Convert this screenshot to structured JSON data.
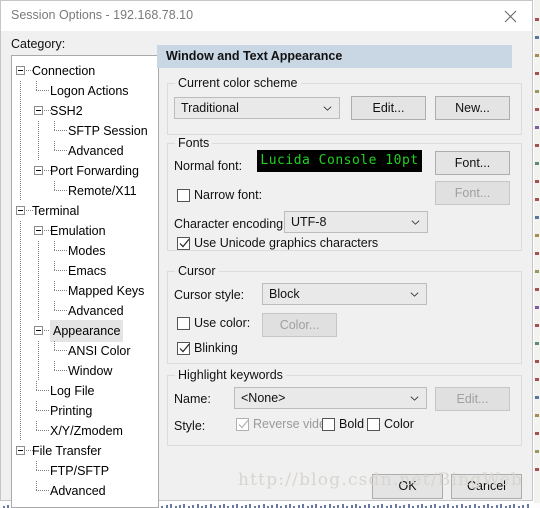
{
  "window": {
    "title": "Session Options - 192.168.78.10",
    "close_icon": "close-icon"
  },
  "category": {
    "label": "Category:",
    "selected": "Appearance",
    "tree": [
      {
        "label": "Connection",
        "depth": 0,
        "expander": "minus"
      },
      {
        "label": "Logon Actions",
        "depth": 1,
        "expander": "none"
      },
      {
        "label": "SSH2",
        "depth": 1,
        "expander": "minus"
      },
      {
        "label": "SFTP Session",
        "depth": 2,
        "expander": "none"
      },
      {
        "label": "Advanced",
        "depth": 2,
        "expander": "none"
      },
      {
        "label": "Port Forwarding",
        "depth": 1,
        "expander": "minus"
      },
      {
        "label": "Remote/X11",
        "depth": 2,
        "expander": "none"
      },
      {
        "label": "Terminal",
        "depth": 0,
        "expander": "minus"
      },
      {
        "label": "Emulation",
        "depth": 1,
        "expander": "minus"
      },
      {
        "label": "Modes",
        "depth": 2,
        "expander": "none"
      },
      {
        "label": "Emacs",
        "depth": 2,
        "expander": "none"
      },
      {
        "label": "Mapped Keys",
        "depth": 2,
        "expander": "none"
      },
      {
        "label": "Advanced",
        "depth": 2,
        "expander": "none"
      },
      {
        "label": "Appearance",
        "depth": 1,
        "expander": "minus",
        "selected": true
      },
      {
        "label": "ANSI Color",
        "depth": 2,
        "expander": "none"
      },
      {
        "label": "Window",
        "depth": 2,
        "expander": "none"
      },
      {
        "label": "Log File",
        "depth": 1,
        "expander": "none"
      },
      {
        "label": "Printing",
        "depth": 1,
        "expander": "none"
      },
      {
        "label": "X/Y/Zmodem",
        "depth": 1,
        "expander": "none"
      },
      {
        "label": "File Transfer",
        "depth": 0,
        "expander": "minus"
      },
      {
        "label": "FTP/SFTP",
        "depth": 1,
        "expander": "none"
      },
      {
        "label": "Advanced",
        "depth": 1,
        "expander": "none"
      }
    ]
  },
  "panel": {
    "header": "Window and Text Appearance",
    "color_scheme": {
      "legend": "Current color scheme",
      "selected": "Traditional",
      "edit_button": "Edit...",
      "new_button": "New..."
    },
    "fonts": {
      "legend": "Fonts",
      "normal_font_label": "Normal font:",
      "normal_font_preview": "Lucida Console 10pt",
      "normal_font_preview_fg": "#1fd31f",
      "normal_font_preview_bg": "#000000",
      "font_button": "Font...",
      "narrow_font_label": "Narrow font:",
      "narrow_font_checked": false,
      "narrow_font_button": "Font...",
      "narrow_font_button_enabled": false,
      "encoding_label": "Character encoding:",
      "encoding_value": "UTF-8",
      "unicode_graphics_label": "Use Unicode graphics characters",
      "unicode_graphics_checked": true
    },
    "cursor": {
      "legend": "Cursor",
      "style_label": "Cursor style:",
      "style_value": "Block",
      "use_color_label": "Use color:",
      "use_color_checked": false,
      "color_button": "Color...",
      "color_button_enabled": false,
      "blinking_label": "Blinking",
      "blinking_checked": true
    },
    "highlight": {
      "legend": "Highlight keywords",
      "name_label": "Name:",
      "name_value": "<None>",
      "edit_button": "Edit...",
      "edit_button_enabled": false,
      "style_label": "Style:",
      "reverse_video_label": "Reverse video",
      "reverse_video_checked": true,
      "reverse_video_enabled": false,
      "bold_label": "Bold",
      "bold_checked": false,
      "color_label": "Color",
      "color_checked": false
    }
  },
  "footer": {
    "ok_button": "OK",
    "cancel_button": "Cancel"
  },
  "watermark": {
    "text": "http://blog.csdn.net/BingWeb"
  }
}
